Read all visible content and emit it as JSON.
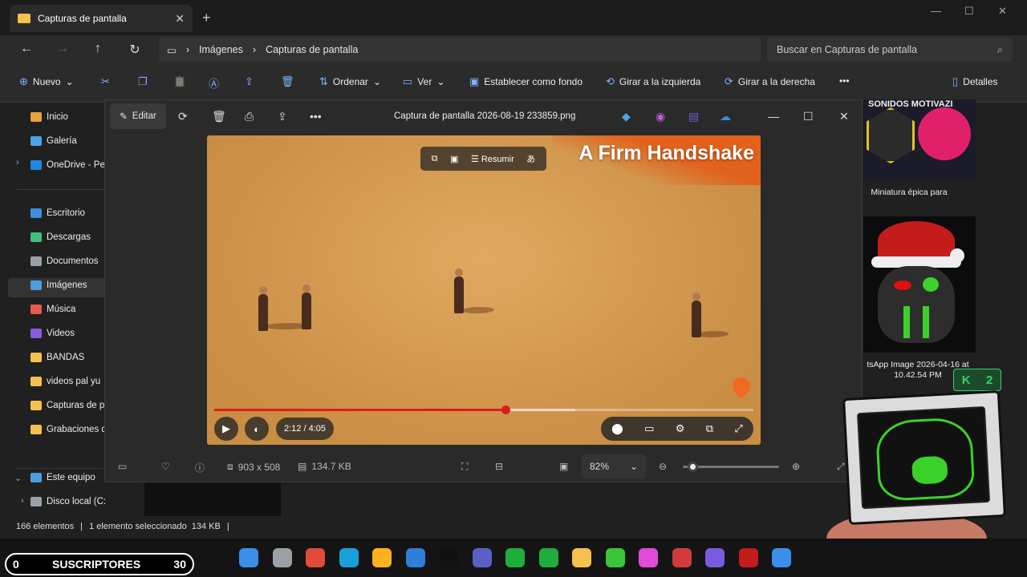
{
  "explorer": {
    "tab_title": "Capturas de pantalla",
    "breadcrumb": [
      "Imágenes",
      "Capturas de pantalla"
    ],
    "search_placeholder": "Buscar en Capturas de pantalla",
    "toolbar": {
      "new": "Nuevo",
      "sort": "Ordenar",
      "view": "Ver",
      "set_background": "Establecer como fondo",
      "rotate_left": "Girar a la izquierda",
      "rotate_right": "Girar a la derecha",
      "details": "Detalles"
    },
    "sidebar": {
      "items": [
        "Inicio",
        "Galería",
        "OneDrive - Pe",
        "Escritorio",
        "Descargas",
        "Documentos",
        "Imágenes",
        "Música",
        "Videos",
        "BANDAS",
        "videos pal yu",
        "Capturas de p",
        "Grabaciones d",
        "Este equipo",
        "Disco local (C:"
      ],
      "icon_colors": [
        "#e8a33a",
        "#4aa3e8",
        "#1e88e5",
        "#3f8ede",
        "#3dc27a",
        "#9aa0a6",
        "#4a9fe0",
        "#e55a4a",
        "#8a5be0",
        "#f2c14e",
        "#f2c14e",
        "#f2c14e",
        "#f2c14e",
        "#4a9fe0",
        "#9aa0a6"
      ]
    },
    "status": {
      "count": "166 elementos",
      "selected": "1 elemento seleccionado",
      "size": "134 KB"
    }
  },
  "viewer": {
    "edit_label": "Editar",
    "file_title": "Captura de pantalla 2026-08-19 233859.png",
    "video": {
      "banner": "A Firm Handshake",
      "ai_summary": "Resumir",
      "time": "2:12 / 4:05",
      "progress": 0.54,
      "buffered": 0.67
    },
    "info": {
      "dimensions": "903 x 508",
      "filesize": "134.7 KB",
      "zoom": "82%",
      "zoom_level": 0.1
    }
  },
  "gallery": {
    "thumb1_header": "SONIDOS MOTIVAZI",
    "thumb1_caption": "Miniatura épica para",
    "thumb2_caption_line1": "tsApp Image 2026-04-16 at",
    "thumb2_caption_line2": "10.42.54 PM"
  },
  "overlay": {
    "k_badge_letter": "K",
    "k_badge_count": "2",
    "subs_left": "0",
    "subs_label": "SUSCRIPTORES",
    "subs_right": "30"
  },
  "taskbar": {
    "icon_colors": [
      "#3b8eea",
      "#9aa0a6",
      "#e04b3a",
      "#1aa0d8",
      "#ffb020",
      "#2f7ed8",
      "#111111",
      "#5b5fc7",
      "#1fae3b",
      "#1fae3b",
      "#f2c14e",
      "#3cc43c",
      "#e04bd8",
      "#d23b3b",
      "#7a5be0",
      "#c41b1b",
      "#3b8eea"
    ]
  }
}
